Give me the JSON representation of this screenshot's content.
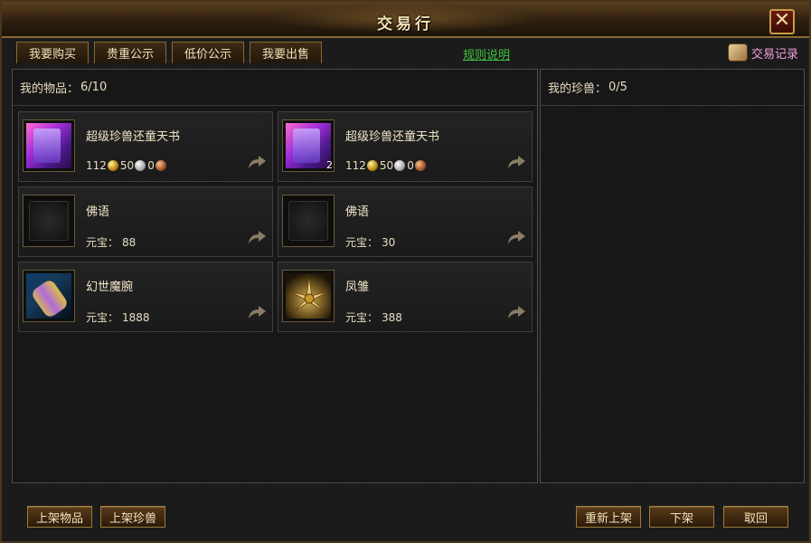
{
  "window": {
    "title": "交易行"
  },
  "tabs": [
    {
      "label": "我要购买"
    },
    {
      "label": "贵重公示"
    },
    {
      "label": "低价公示"
    },
    {
      "label": "我要出售"
    }
  ],
  "rules_link": "规则说明",
  "trade_record": "交易记录",
  "left_panel": {
    "label": "我的物品：",
    "count": "6/10"
  },
  "right_panel": {
    "label": "我的珍兽：",
    "count": "0/5"
  },
  "price_label": "元宝：",
  "items": [
    {
      "name": "超级珍兽还童天书",
      "icon": "purple-scroll-icon",
      "stack": "",
      "gold": "112",
      "silver": "50",
      "copper": "0"
    },
    {
      "name": "超级珍兽还童天书",
      "icon": "purple-scroll-icon",
      "stack": "2",
      "gold": "112",
      "silver": "50",
      "copper": "0"
    },
    {
      "name": "佛语",
      "icon": "empty-slot-icon",
      "yuanbao": "88"
    },
    {
      "name": "佛语",
      "icon": "empty-slot-icon",
      "yuanbao": "30"
    },
    {
      "name": "幻世魔腕",
      "icon": "bracelet-icon",
      "yuanbao": "1888"
    },
    {
      "name": "凤雏",
      "icon": "golden-fan-icon",
      "yuanbao": "388"
    }
  ],
  "buttons": {
    "list_item": "上架物品",
    "list_pet": "上架珍兽",
    "relist": "重新上架",
    "delist": "下架",
    "cancel": "取回"
  },
  "colors": {
    "rules_link": "#3ec43e",
    "trade_record": "#f0a0e0",
    "border_gold": "#a07a3a"
  }
}
